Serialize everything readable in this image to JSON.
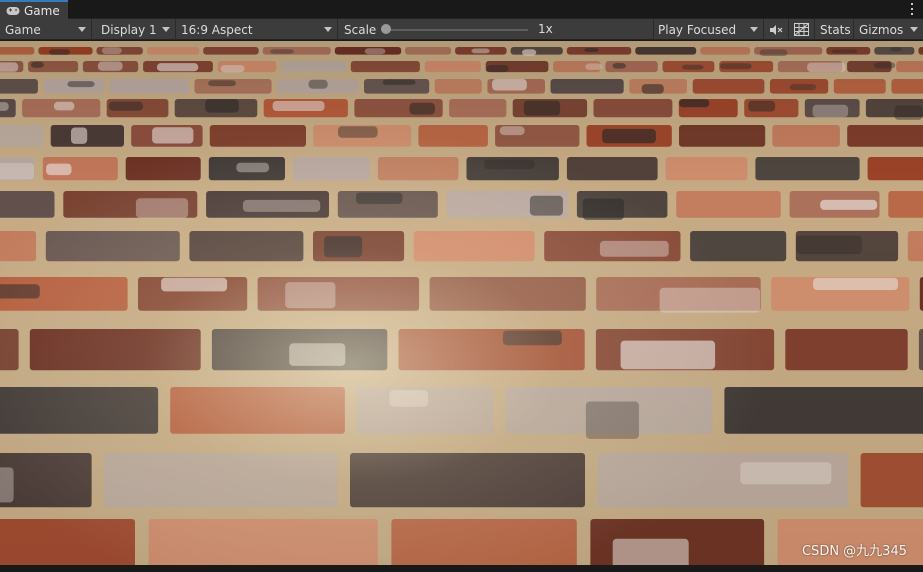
{
  "tab": {
    "label": "Game",
    "icon": "gamepad-icon"
  },
  "toolbar": {
    "view_mode": "Game",
    "display": "Display 1",
    "aspect": "16:9 Aspect",
    "scale_label": "Scale",
    "scale_value": "1x",
    "scale_fraction": 0,
    "play_mode": "Play Focused",
    "mute_icon": "mute-audio-icon",
    "grid_icon": "gizmo-grid-icon",
    "stats_label": "Stats",
    "gizmos_label": "Gizmos"
  },
  "viewport": {
    "content": "brick-floor-scene",
    "watermark": "CSDN @九九345"
  },
  "colors": {
    "tab_accent": "#3a79bb",
    "toolbar_bg": "#3c3c3c",
    "panel_bg": "#191919",
    "mortar": "#c9b08a"
  }
}
